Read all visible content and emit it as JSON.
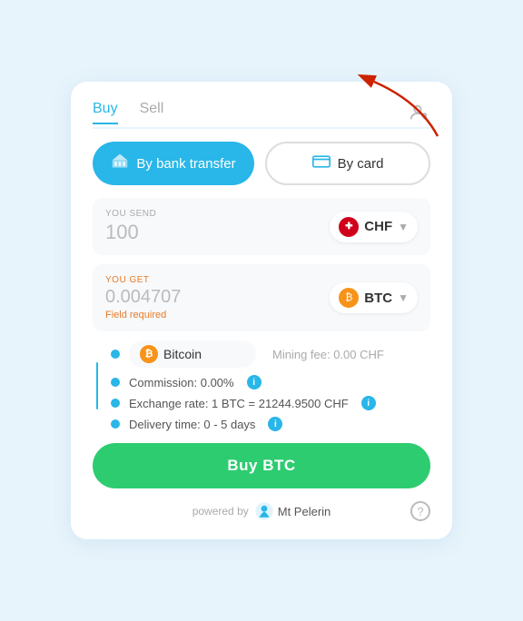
{
  "tabs": {
    "buy": "Buy",
    "sell": "Sell",
    "active": "buy"
  },
  "payment": {
    "bank_label": "By bank transfer",
    "card_label": "By card"
  },
  "send": {
    "label": "YOU SEND",
    "value": "100",
    "currency": "CHF"
  },
  "get": {
    "label": "YOU GET",
    "value": "0.004707",
    "currency": "BTC",
    "error": "Field required"
  },
  "details": {
    "crypto_name": "Bitcoin",
    "mining_fee": "Mining fee: 0.00 CHF",
    "commission": "Commission: 0.00%",
    "exchange_rate": "Exchange rate: 1 BTC = 21244.9500 CHF",
    "delivery_time": "Delivery time: 0 - 5 days"
  },
  "buy_button": "Buy BTC",
  "footer": {
    "powered_by": "powered by",
    "brand": "Mt\nPelerin"
  }
}
